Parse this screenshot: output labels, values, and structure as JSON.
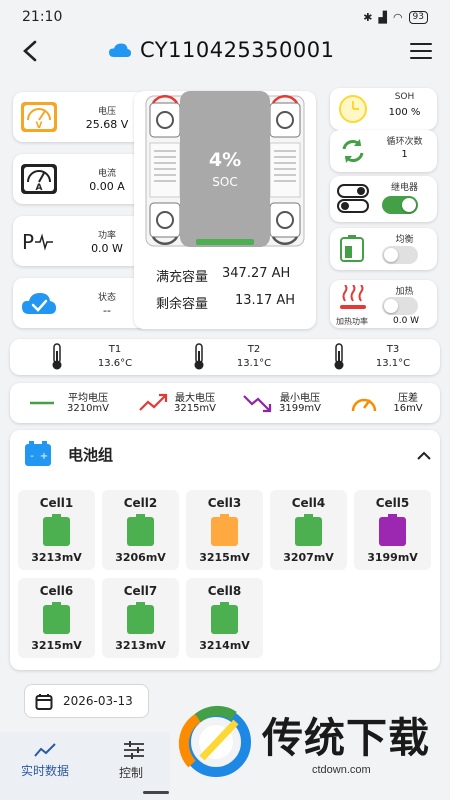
{
  "status": {
    "time": "21:10",
    "battery": "93"
  },
  "header": {
    "title": "CY110425350001"
  },
  "left_cards": [
    {
      "label": "电压",
      "value": "25.68 V"
    },
    {
      "label": "电流",
      "value": "0.00 A"
    },
    {
      "label": "功率",
      "value": "0.0 W"
    },
    {
      "label": "状态",
      "value": "--"
    }
  ],
  "soc": {
    "percent": "4%",
    "label": "SOC",
    "fill_fraction": 0.04
  },
  "capacity": {
    "full_label": "满充容量",
    "full_value": "347.27 AH",
    "remain_label": "剩余容量",
    "remain_value": "13.17 AH"
  },
  "right_cards": {
    "soh": {
      "label": "SOH",
      "value": "100 %"
    },
    "cycles": {
      "label": "循环次数",
      "value": "1"
    },
    "relay": {
      "label": "继电器",
      "on": true
    },
    "balance": {
      "label": "均衡",
      "on": false
    },
    "heating": {
      "label": "加热",
      "on": false,
      "power_label": "加热功率",
      "power_value": "0.0 W"
    }
  },
  "temps": [
    {
      "name": "T1",
      "value": "13.6°C"
    },
    {
      "name": "T2",
      "value": "13.1°C"
    },
    {
      "name": "T3",
      "value": "13.1°C"
    }
  ],
  "voltages": [
    {
      "label": "平均电压",
      "value": "3210mV"
    },
    {
      "label": "最大电压",
      "value": "3215mV"
    },
    {
      "label": "最小电压",
      "value": "3199mV"
    },
    {
      "label": "压差",
      "value": "16mV"
    }
  ],
  "pack": {
    "title": "电池组",
    "cells": [
      {
        "name": "Cell1",
        "value": "3213mV",
        "color": "#4caf50"
      },
      {
        "name": "Cell2",
        "value": "3206mV",
        "color": "#4caf50"
      },
      {
        "name": "Cell3",
        "value": "3215mV",
        "color": "#ffa940"
      },
      {
        "name": "Cell4",
        "value": "3207mV",
        "color": "#4caf50"
      },
      {
        "name": "Cell5",
        "value": "3199mV",
        "color": "#9c27b0"
      },
      {
        "name": "Cell6",
        "value": "3215mV",
        "color": "#4caf50"
      },
      {
        "name": "Cell7",
        "value": "3213mV",
        "color": "#4caf50"
      },
      {
        "name": "Cell8",
        "value": "3214mV",
        "color": "#4caf50"
      }
    ]
  },
  "date": "2026-03-13",
  "tabs": [
    {
      "label": "实时数据",
      "icon": "chart-line-icon"
    },
    {
      "label": "控制",
      "icon": "sliders-icon"
    }
  ],
  "watermark": {
    "text": "传统下载",
    "url": "ctdown.com"
  },
  "colors": {
    "accent": "#2196f3",
    "green": "#4caf50",
    "orange": "#ffa940",
    "purple": "#9c27b0",
    "toggle_on": "#43a047",
    "toggle_off": "#e0e0e0"
  }
}
